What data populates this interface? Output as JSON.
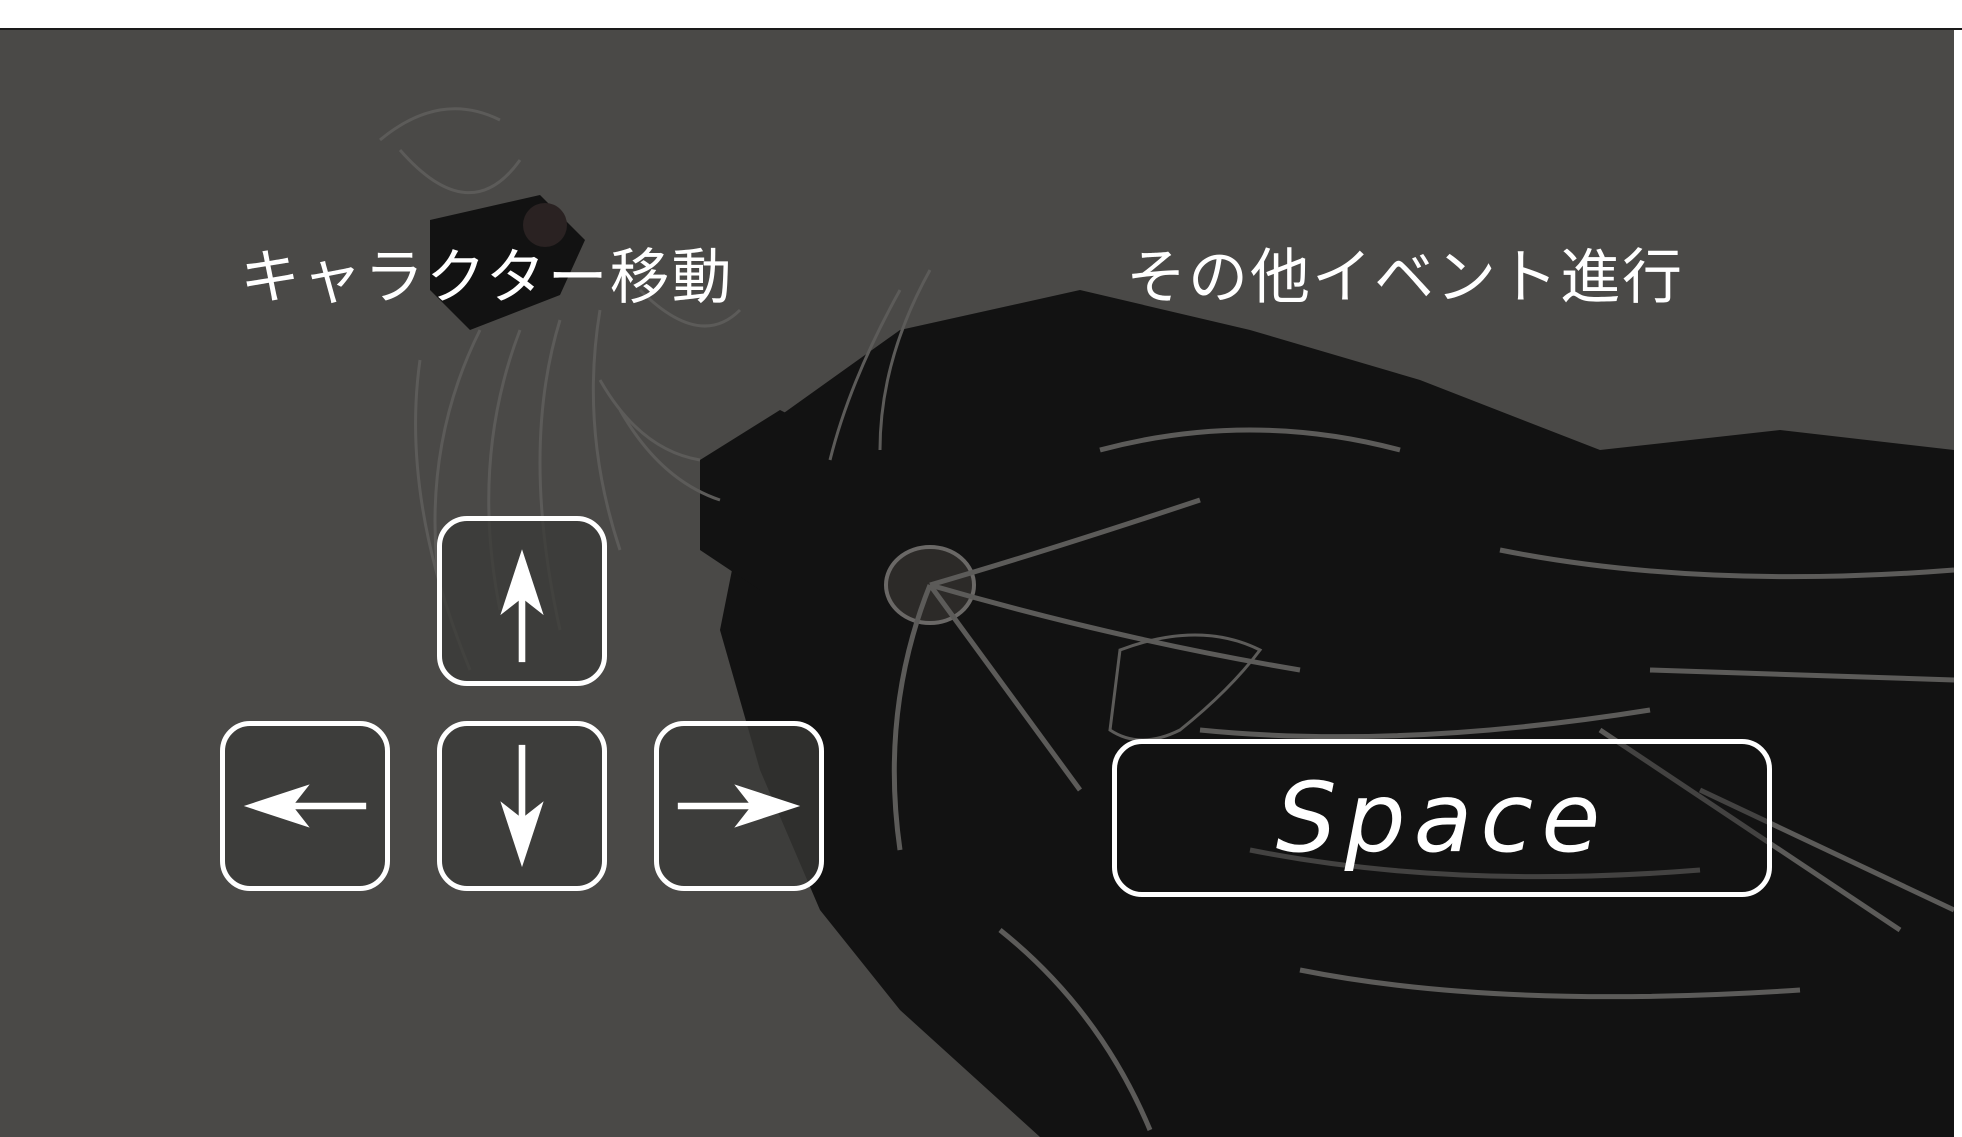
{
  "colors": {
    "background": "#4a4947",
    "silhouette": "#121212",
    "line_art": "#5c5b59",
    "key_border": "#ffffff",
    "text": "#ffffff"
  },
  "labels": {
    "movement": "キャラクター移動",
    "event": "その他イベント進行"
  },
  "keys": {
    "up": {
      "icon": "arrow-up-icon"
    },
    "left": {
      "icon": "arrow-left-icon"
    },
    "down": {
      "icon": "arrow-down-icon"
    },
    "right": {
      "icon": "arrow-right-icon"
    },
    "space": {
      "label": "Space"
    }
  },
  "background_art": "sleeping-girl-illustration"
}
